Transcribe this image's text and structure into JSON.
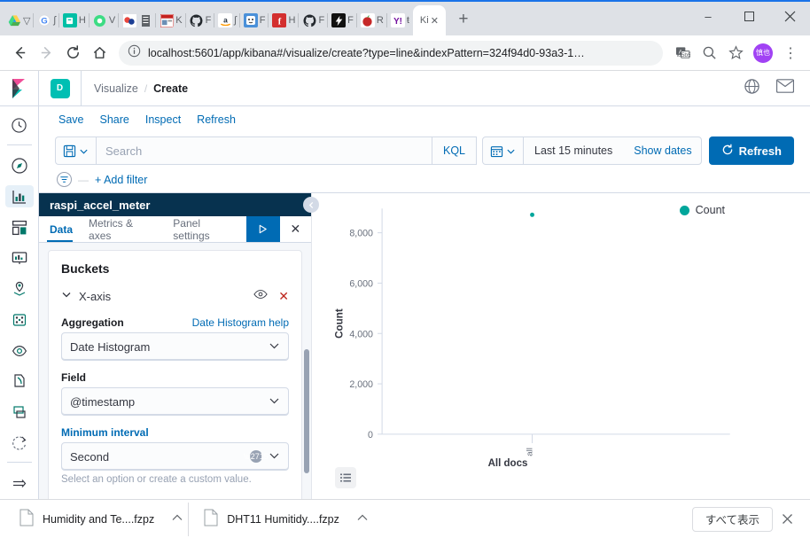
{
  "browser": {
    "tabs": [
      {
        "letter": "▽",
        "icon": "drive-icon",
        "color": "#4285f4"
      },
      {
        "letter": "ʃ",
        "icon": "google-icon",
        "color": "#ffffff"
      },
      {
        "letter": "H",
        "icon": "evernote-icon",
        "color": "#00bfa5"
      },
      {
        "letter": "V",
        "icon": "green-circle-icon",
        "color": "#3ddc84"
      },
      {
        "letter": "ā",
        "icon": "colorful-icon",
        "color": "#e8453c"
      },
      {
        "letter": "K",
        "icon": "news-icon",
        "color": "#c5221f"
      },
      {
        "letter": "F",
        "icon": "github-icon",
        "color": "#24292e"
      },
      {
        "letter": "ʃ",
        "icon": "amazon-icon",
        "color": "#ff9900"
      },
      {
        "letter": "F",
        "icon": "smiley-icon",
        "color": "#4a90d9"
      },
      {
        "letter": "H",
        "icon": "facebook-f-icon",
        "color": "#d32f2f"
      },
      {
        "letter": "F",
        "icon": "github2-icon",
        "color": "#24292e"
      },
      {
        "letter": "F",
        "icon": "flash-icon",
        "color": "#111111"
      },
      {
        "letter": "R",
        "icon": "apple-icon",
        "color": "#c62828"
      },
      {
        "letter": "ŧ",
        "icon": "yahoo-icon",
        "color": "#720e9e"
      }
    ],
    "active_tab": {
      "letter": "Ki",
      "icon": "kibana-icon",
      "close": "✕"
    },
    "new_tab": "+",
    "window_controls": {
      "minimize": "–",
      "maximize": "⬜",
      "close": "✕"
    },
    "toolbar": {
      "back": "←",
      "forward": "→",
      "reload": "⟳",
      "home": "⌂",
      "info_icon": "ⓘ",
      "url": "localhost:5601/app/kibana#/visualize/create?type=line&indexPattern=324f94d0-93a3-1…",
      "translate_icon": "translate-icon",
      "zoom_icon": "⌕",
      "bookmark_icon": "☆",
      "avatar_text": "慎也",
      "menu_icon": "⋮"
    }
  },
  "kibana": {
    "space_badge": "D",
    "breadcrumbs": [
      {
        "label": "Visualize",
        "current": false
      },
      {
        "label": "Create",
        "current": true
      }
    ],
    "breadcrumb_separator": "/",
    "header_icons": [
      "globe-icon",
      "mail-icon"
    ],
    "nav_items": [
      {
        "name": "recently-viewed",
        "icon": "clock-icon",
        "selected": false
      },
      {
        "name": "discover",
        "icon": "compass-icon",
        "selected": false
      },
      {
        "name": "visualize",
        "icon": "bar-chart-icon",
        "selected": true
      },
      {
        "name": "dashboard",
        "icon": "dashboard-icon",
        "selected": false
      },
      {
        "name": "canvas",
        "icon": "presentation-icon",
        "selected": false
      },
      {
        "name": "maps",
        "icon": "map-pin-icon",
        "selected": false
      },
      {
        "name": "machine-learning",
        "icon": "graph-nodes-icon",
        "selected": false
      },
      {
        "name": "infrastructure",
        "icon": "eye-icon",
        "selected": false
      },
      {
        "name": "logs",
        "icon": "logs-icon",
        "selected": false
      },
      {
        "name": "apm",
        "icon": "apm-icon",
        "selected": false
      },
      {
        "name": "uptime",
        "icon": "uptime-icon",
        "selected": false
      },
      {
        "name": "collapse-nav",
        "icon": "arrow-right-icon",
        "selected": false
      }
    ],
    "vis_toolbar": [
      "Save",
      "Share",
      "Inspect",
      "Refresh"
    ],
    "query_bar": {
      "saved_query_icon": "save-disk-icon",
      "search_placeholder": "Search",
      "language": "KQL",
      "calendar_icon": "calendar-icon",
      "date_range": "Last 15 minutes",
      "show_dates": "Show dates",
      "refresh_label": "Refresh",
      "refresh_icon": "refresh-icon"
    },
    "filter_bar": {
      "filter_icon": "filter-icon",
      "dash": "—",
      "add_filter": "+ Add filter"
    }
  },
  "editor": {
    "title": "raspi_accel_meter",
    "tabs": [
      {
        "label": "Data",
        "active": true
      },
      {
        "label": "Metrics & axes",
        "active": false
      },
      {
        "label": "Panel settings",
        "active": false
      }
    ],
    "apply_icon": "play-icon",
    "close_icon": "✕",
    "section_title": "Buckets",
    "bucket": {
      "collapse_icon": "chevron-down-icon",
      "label": "X-axis",
      "visibility_icon": "eye-icon",
      "remove_icon": "✕"
    },
    "fields": [
      {
        "label": "Aggregation",
        "help_link": "Date Histogram help",
        "value": "Date Histogram",
        "clearable": false,
        "link_label": false,
        "hint": ""
      },
      {
        "label": "Field",
        "help_link": "",
        "value": "@timestamp",
        "clearable": false,
        "link_label": false,
        "hint": ""
      },
      {
        "label": "Minimum interval",
        "help_link": "",
        "value": "Second",
        "clearable": true,
        "link_label": true,
        "hint": "Select an option or create a custom value."
      }
    ]
  },
  "chart_data": {
    "type": "scatter",
    "title": "",
    "xlabel": "All docs",
    "ylabel": "Count",
    "categories": [
      "all"
    ],
    "values": [
      8720
    ],
    "ylim": [
      0,
      9000
    ],
    "yticks": [
      0,
      2000,
      4000,
      6000,
      8000
    ],
    "ytick_labels": [
      "0",
      "2,000",
      "4,000",
      "6,000",
      "8,000"
    ],
    "xtick_labels": [
      "all"
    ],
    "legend": [
      {
        "label": "Count",
        "color": "#00a69b"
      }
    ],
    "legend_position": "top-right",
    "grid": false,
    "series_color": "#00a69b",
    "collapse_icon": "chevron-left-icon",
    "table_toggle_icon": "list-icon"
  },
  "downloads": {
    "items": [
      {
        "name": "Humidity and Te....fzpz",
        "icon": "file-icon",
        "caret": "⌃"
      },
      {
        "name": "DHT11 Humitidy....fzpz",
        "icon": "file-icon",
        "caret": "⌃"
      }
    ],
    "show_all": "すべて表示",
    "close": "✕"
  }
}
